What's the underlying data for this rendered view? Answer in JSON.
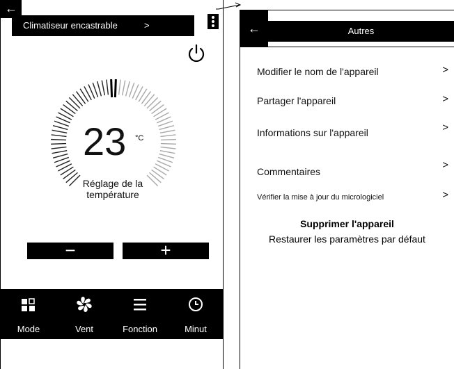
{
  "left_screen": {
    "title": "Climatiseur encastrable",
    "title_arrow": ">",
    "back_icon": "←",
    "temperature": "23",
    "unit": "°C",
    "dial_label_line1": "Réglage de la",
    "dial_label_line2": "température",
    "minus_label": "−",
    "plus_label": "+",
    "tabs": [
      {
        "label": "Mode",
        "icon": "mode-icon"
      },
      {
        "label": "Vent",
        "icon": "fan-icon"
      },
      {
        "label": "Fonction",
        "icon": "menu-icon"
      },
      {
        "label": "Minut",
        "icon": "clock-icon"
      }
    ]
  },
  "right_screen": {
    "title": "Autres",
    "back_icon": "←",
    "chevron": ">",
    "items": [
      {
        "label": "Modifier le nom de l'appareil"
      },
      {
        "label": "Partager l'appareil"
      },
      {
        "label": "Informations sur l'appareil"
      },
      {
        "label": "Commentaires"
      },
      {
        "label": "Vérifier la mise à jour du micrologiciel"
      }
    ],
    "delete_label": "Supprimer l'appareil",
    "reset_label": "Restaurer les paramètres par défaut"
  }
}
